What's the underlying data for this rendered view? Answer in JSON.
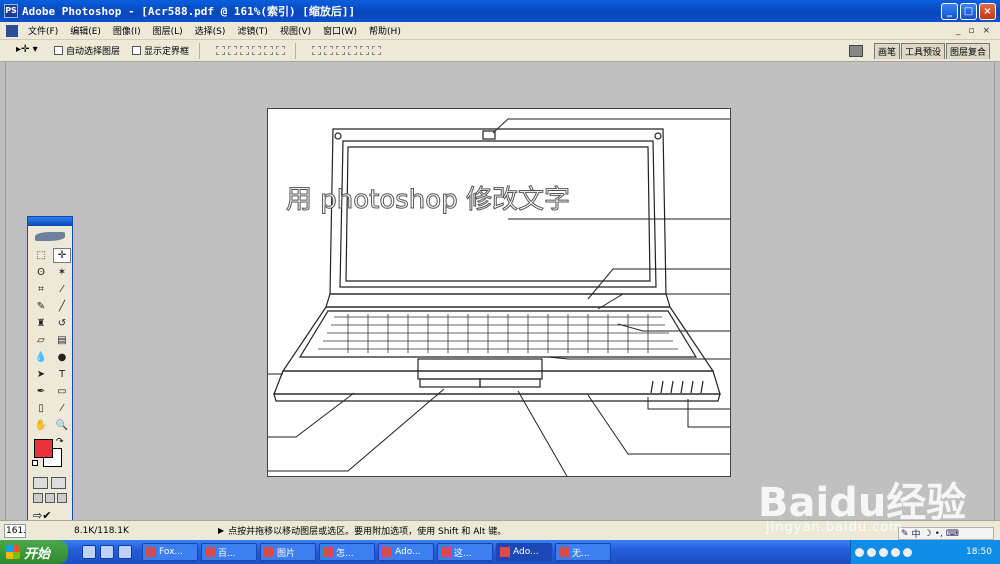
{
  "window": {
    "title": "Adobe Photoshop - [Acr588.pdf @ 161%(索引) [缩放后]]",
    "app_icon_text": "PS"
  },
  "menu": [
    "文件(F)",
    "编辑(E)",
    "图像(I)",
    "图层(L)",
    "选择(S)",
    "滤镜(T)",
    "视图(V)",
    "窗口(W)",
    "帮助(H)"
  ],
  "options": {
    "auto_select_layer": "自动选择图层",
    "show_bounding_box": "显示定界框"
  },
  "palette_well": [
    "画笔",
    "工具预设",
    "图层复合"
  ],
  "canvas": {
    "overlay_text": "用 photoshop 修改文字"
  },
  "status": {
    "zoom": "161.",
    "doc_size": "8.1K/118.1K",
    "hint": "点按并拖移以移动图层或选区。要用附加选项，使用 Shift 和 Alt 键。"
  },
  "taskbar": {
    "start_label": "开始",
    "tasks": [
      {
        "label": "Fox...",
        "icon": "foxit-icon",
        "active": false
      },
      {
        "label": "百...",
        "icon": "folder-icon",
        "active": false
      },
      {
        "label": "图片",
        "icon": "folder-icon",
        "active": false
      },
      {
        "label": "怎...",
        "icon": "word-icon",
        "active": false
      },
      {
        "label": "Ado...",
        "icon": "acrobat-icon",
        "active": false
      },
      {
        "label": "这...",
        "icon": "app-icon",
        "active": false
      },
      {
        "label": "Ado...",
        "icon": "photoshop-icon",
        "active": true
      },
      {
        "label": "无...",
        "icon": "notepad-icon",
        "active": false
      }
    ],
    "clock": "18:50"
  },
  "ime": {
    "label": "中"
  },
  "watermark": {
    "main": "Baidu经验",
    "sub": "jingyan.baidu.com"
  },
  "colors": {
    "foreground": "#e8333a",
    "background": "#ffffff",
    "titlebar": "#0a52d0"
  }
}
